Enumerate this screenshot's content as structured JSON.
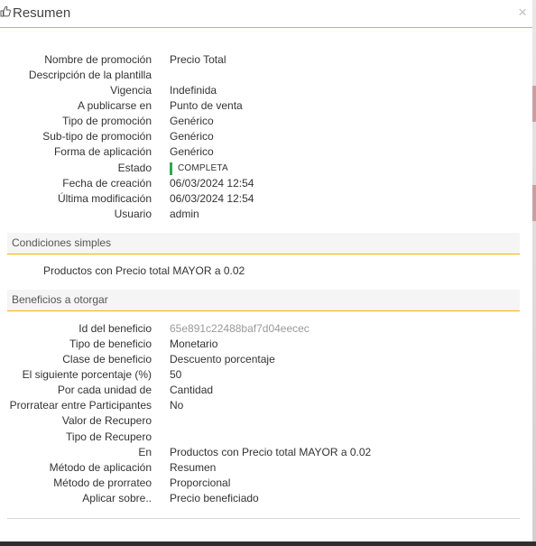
{
  "dialog": {
    "title": "Resumen",
    "close_glyph": "×",
    "icon": "thumbs-up-icon"
  },
  "summary": [
    {
      "label": "Nombre de promoción",
      "value": "Precio Total"
    },
    {
      "label": "Descripción de la plantilla",
      "value": ""
    },
    {
      "label": "Vigencia",
      "value": "Indefinida"
    },
    {
      "label": "A publicarse en",
      "value": "Punto de venta"
    },
    {
      "label": "Tipo de promoción",
      "value": "Genérico"
    },
    {
      "label": "Sub-tipo de promoción",
      "value": "Genérico"
    },
    {
      "label": "Forma de aplicación",
      "value": "Genérico"
    },
    {
      "label": "Estado",
      "value": "COMPLETA"
    },
    {
      "label": "Fecha de creación",
      "value": "06/03/2024 12:54"
    },
    {
      "label": "Última modificación",
      "value": "06/03/2024 12:54"
    },
    {
      "label": "Usuario",
      "value": "admin"
    }
  ],
  "status_color": "#2ea84a",
  "accent_color": "#f0b400",
  "conditions": {
    "title": "Condiciones simples",
    "text": "Productos con Precio total MAYOR a 0.02"
  },
  "benefits": {
    "title": "Beneficios a otorgar",
    "rows": [
      {
        "label": "Id del beneficio",
        "value": "65e891c22488baf7d04eecec"
      },
      {
        "label": "Tipo de beneficio",
        "value": "Monetario"
      },
      {
        "label": "Clase de beneficio",
        "value": "Descuento porcentaje"
      },
      {
        "label": "El siguiente porcentaje (%)",
        "value": "50"
      },
      {
        "label": "Por cada unidad de",
        "value": "Cantidad"
      },
      {
        "label": "Prorratear entre Participantes",
        "value": "No"
      },
      {
        "label": "Valor de Recupero",
        "value": ""
      },
      {
        "label": "Tipo de Recupero",
        "value": ""
      },
      {
        "label": "En",
        "value": "Productos con Precio total MAYOR a 0.02"
      },
      {
        "label": "Método de aplicación",
        "value": "Resumen"
      },
      {
        "label": "Método de prorrateo",
        "value": "Proporcional"
      },
      {
        "label": "Aplicar sobre..",
        "value": "Precio beneficiado"
      }
    ]
  }
}
